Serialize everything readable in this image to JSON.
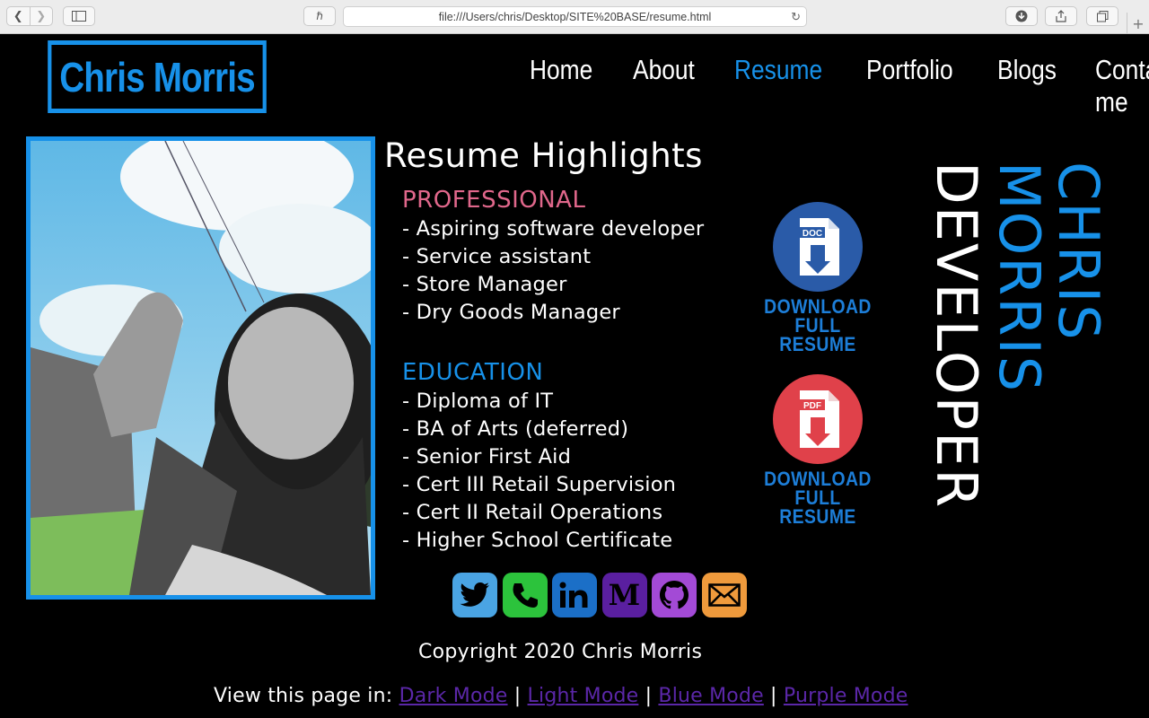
{
  "browser": {
    "url": "file:///Users/chris/Desktop/SITE%20BASE/resume.html"
  },
  "site": {
    "logo": "Chris Morris",
    "nav": [
      "Home",
      "About",
      "Resume",
      "Portfolio",
      "Blogs",
      "Contact me"
    ],
    "active_nav": "Resume"
  },
  "resume": {
    "heading": "Resume Highlights",
    "professional_title": "PROFESSIONAL",
    "professional": [
      "- Aspiring software developer",
      "- Service assistant",
      "- Store Manager",
      "- Dry Goods Manager"
    ],
    "education_title": "EDUCATION",
    "education": [
      "- Diploma of IT",
      "- BA of Arts (deferred)",
      "- Senior First Aid",
      "- Cert III Retail Supervision",
      "- Cert II Retail Operations",
      "- Higher School Certificate"
    ]
  },
  "downloads": {
    "doc": {
      "badge": "DOC",
      "line1": "DOWNLOAD",
      "line2": "FULL RESUME"
    },
    "pdf": {
      "badge": "PDF",
      "line1": "DOWNLOAD",
      "line2": "FULL RESUME"
    }
  },
  "social": [
    "twitter-icon",
    "phone-icon",
    "linkedin-icon",
    "medium-icon",
    "github-icon",
    "email-icon"
  ],
  "vertical": {
    "col1": "CHRIS",
    "col2": "MORRIS",
    "col3": "DEVELOPER"
  },
  "footer": {
    "copyright": "Copyright 2020 Chris Morris",
    "view_label": "View this page in:",
    "modes": [
      "Dark Mode",
      "Light Mode",
      "Blue Mode",
      "Purple Mode"
    ],
    "separator": "|"
  },
  "colors": {
    "accent": "#1791e9",
    "professional": "#e0678b",
    "visited_link": "#5b27a8"
  }
}
